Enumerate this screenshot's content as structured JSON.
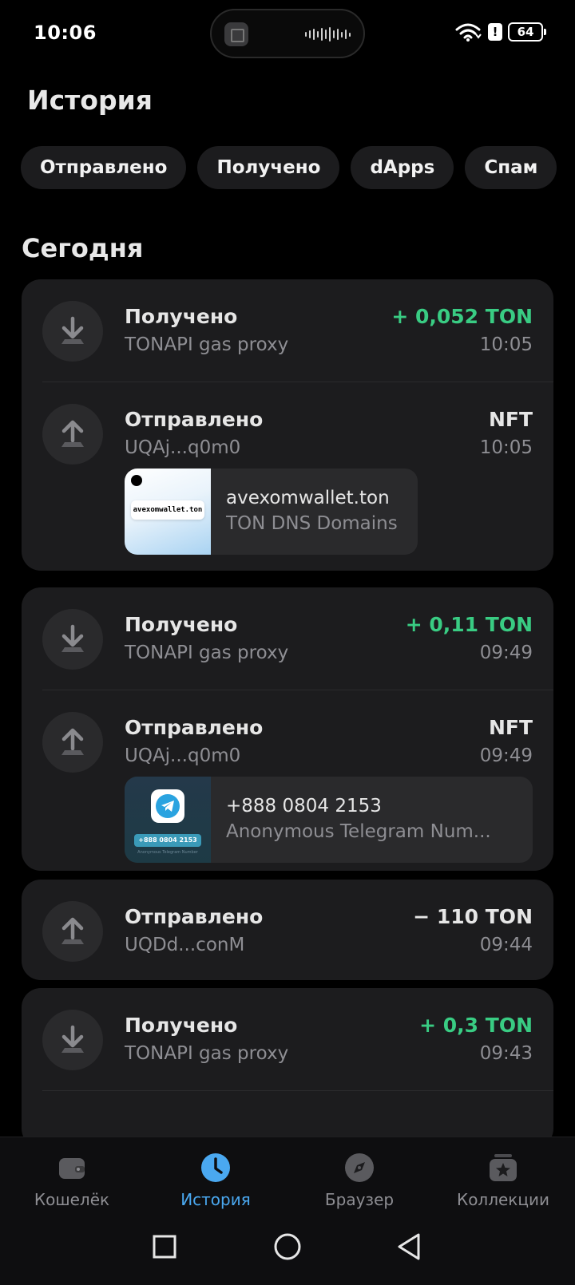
{
  "status_bar": {
    "time": "10:06",
    "battery": "64"
  },
  "header": {
    "title": "История"
  },
  "filters": [
    "Отправлено",
    "Получено",
    "dApps",
    "Спам"
  ],
  "section": {
    "title": "Сегодня"
  },
  "transactions": [
    {
      "type": "Получено",
      "counterparty": "TONAPI gas proxy",
      "amount": "+ 0,052 TON",
      "time": "10:05",
      "direction": "in"
    },
    {
      "type": "Отправлено",
      "counterparty": "UQAj...q0m0",
      "amount": "NFT",
      "time": "10:05",
      "direction": "out",
      "nft": {
        "name": "avexomwallet.ton",
        "collection": "TON DNS Domains",
        "thumb_text": "avexomwallet.ton"
      }
    },
    {
      "type": "Получено",
      "counterparty": "TONAPI gas proxy",
      "amount": "+ 0,11 TON",
      "time": "09:49",
      "direction": "in"
    },
    {
      "type": "Отправлено",
      "counterparty": "UQAj...q0m0",
      "amount": "NFT",
      "time": "09:49",
      "direction": "out",
      "nft": {
        "name": "+888 0804 2153",
        "collection": "Anonymous Telegram Num...",
        "thumb_text": "+888 0804 2153",
        "thumb_caption": "Anonymous Telegram Number"
      }
    },
    {
      "type": "Отправлено",
      "counterparty": "UQDd...conM",
      "amount": "− 110 TON",
      "time": "09:44",
      "direction": "out"
    },
    {
      "type": "Получено",
      "counterparty": "TONAPI gas proxy",
      "amount": "+ 0,3 TON",
      "time": "09:43",
      "direction": "in"
    }
  ],
  "bottom_nav": [
    {
      "label": "Кошелёк",
      "icon": "wallet-icon"
    },
    {
      "label": "История",
      "icon": "clock-icon",
      "active": true
    },
    {
      "label": "Браузер",
      "icon": "compass-icon"
    },
    {
      "label": "Коллекции",
      "icon": "collections-icon"
    }
  ],
  "colors": {
    "accent": "#4aa8f0",
    "positive": "#39cc83",
    "card": "#1c1c1e",
    "muted": "#8e8e93"
  }
}
